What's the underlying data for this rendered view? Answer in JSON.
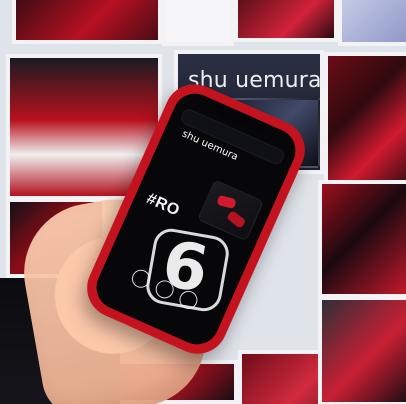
{
  "scene": {
    "ad_brand_text": "shu uemura",
    "phone": {
      "status_time": "",
      "status_right": "",
      "url": "",
      "brand": "shu uemura",
      "hashtag": "#RO",
      "big_number": "6",
      "note": "",
      "buttons": [
        "",
        "",
        ""
      ],
      "bottom_icons": [
        "",
        "",
        "",
        ""
      ]
    }
  },
  "colors": {
    "phone_red": "#c4131f",
    "screen_black": "#07070a",
    "accent_red": "#d11a2d"
  }
}
